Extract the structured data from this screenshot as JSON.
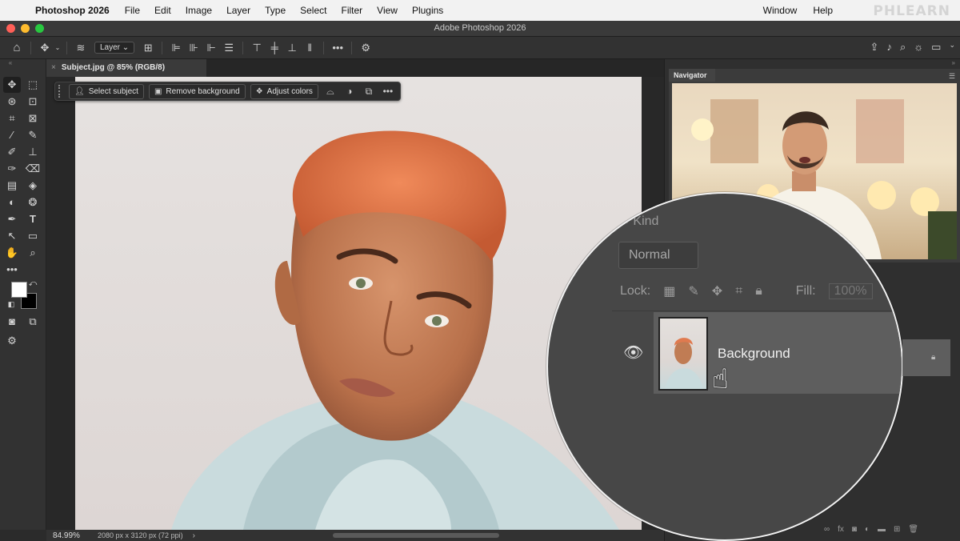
{
  "menubar": {
    "app_name": "Photoshop 2026",
    "items": [
      "File",
      "Edit",
      "Image",
      "Layer",
      "Type",
      "Select",
      "Filter",
      "View",
      "Plugins",
      "Window",
      "Help"
    ],
    "watermark": "PHLEARN"
  },
  "window": {
    "title": "Adobe Photoshop 2026"
  },
  "options_bar": {
    "auto_select_target": "Layer"
  },
  "document_tab": {
    "label": "Subject.jpg @ 85% (RGB/8)"
  },
  "contextual_taskbar": {
    "select_subject": "Select subject",
    "remove_background": "Remove background",
    "adjust_colors": "Adjust colors"
  },
  "status_bar": {
    "zoom": "84.99%",
    "dimensions": "2080 px x 3120 px (72 ppi)"
  },
  "navigator": {
    "tab_label": "Navigator"
  },
  "layers": {
    "search_placeholder": "Kind",
    "blend_mode": "Normal",
    "lock_label": "Lock:",
    "fill_label": "Fill:",
    "fill_value": "100%",
    "layer_name": "Background"
  },
  "colors": {
    "foreground": "#ffffff",
    "background": "#000000",
    "accent_hair": "#e07a4f"
  }
}
